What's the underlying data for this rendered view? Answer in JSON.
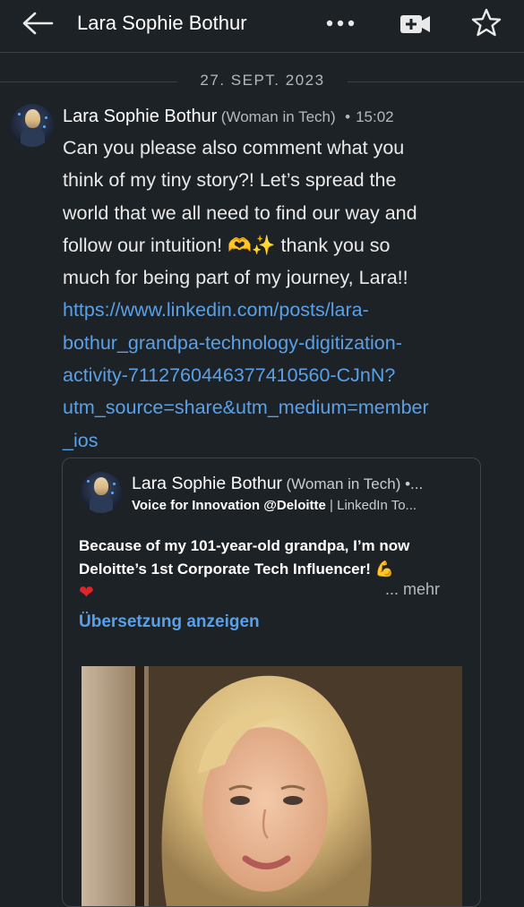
{
  "header": {
    "title": "Lara Sophie Bothur",
    "icons": [
      "back-arrow-icon",
      "more-horizontal-icon",
      "video-call-icon",
      "star-icon"
    ]
  },
  "date_separator": "27. SEPT. 2023",
  "message": {
    "sender_name": "Lara Sophie Bothur",
    "sender_headline": "(Woman in Tech)",
    "separator": "•",
    "time": "15:02",
    "text_lines": [
      "Can you please also comment what you",
      "think of my tiny story?! Let’s spread the",
      "world that we all need to find our way and",
      "follow our intuition! 🫶✨  thank you so",
      "much for being part of my journey, Lara!!"
    ],
    "link_lines": [
      "https://www.linkedin.com/posts/lara-",
      "bothur_grandpa-technology-digitization-",
      "activity-7112760446377410560-CJnN?",
      "utm_source=share&utm_medium=member",
      "_ios"
    ]
  },
  "shared_post": {
    "author_name": "Lara Sophie Bothur",
    "author_headline": "(Woman in Tech) •...",
    "subline_bold": "Voice for Innovation @Deloitte",
    "subline_rest": " | LinkedIn To...",
    "text_line1": "Because of my 101-year-old grandpa, I’m now",
    "text_line2": "Deloitte’s 1st Corporate Tech Influencer! ",
    "flex_emoji": "💪",
    "heart_emoji": "❤",
    "more_label": "... mehr",
    "translate_label": "Übersetzung anzeigen"
  },
  "colors": {
    "background": "#1d2226",
    "link": "#5aa0e8",
    "text": "#e9e9e9",
    "muted": "#b5b9bd",
    "divider": "#3a3f44"
  }
}
